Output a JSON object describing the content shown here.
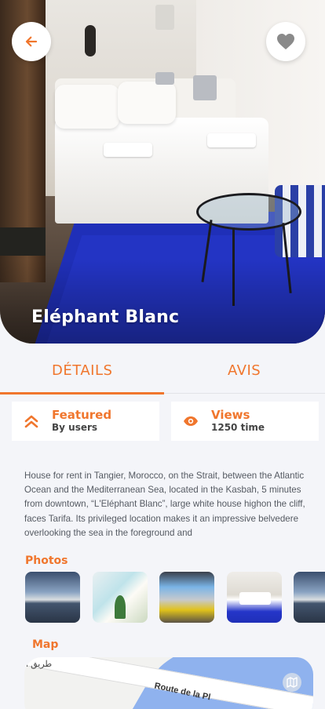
{
  "listing": {
    "title": "Eléphant Blanc",
    "description": "House for rent in Tangier, Morocco, on the Strait, between the Atlantic Ocean and the Mediterranean Sea, located in the Kasbah, 5 minutes from downtown, “L'Eléphant Blanc”, large white house highon the cliff, faces Tarifa. Its privileged location makes it an impressive belvedere overlooking the sea in the foreground and"
  },
  "tabs": {
    "details": "DÉTAILS",
    "reviews": "AVIS",
    "active": "details"
  },
  "stats": {
    "featured": {
      "title": "Featured",
      "subtitle": "By users",
      "icon": "double-chevron-up-icon"
    },
    "views": {
      "title": "Views",
      "subtitle": "1250 time",
      "icon": "eye-icon"
    }
  },
  "sections": {
    "photos": "Photos",
    "map": "Map"
  },
  "map": {
    "label_arabic": "طريق ا",
    "label_route": "Route de la Pl"
  },
  "icons": {
    "back": "arrow-left-icon",
    "favorite": "heart-icon",
    "map_mode": "map-icon"
  },
  "colors": {
    "accent": "#f0762d",
    "background": "#f4f5f9",
    "card": "#ffffff"
  }
}
